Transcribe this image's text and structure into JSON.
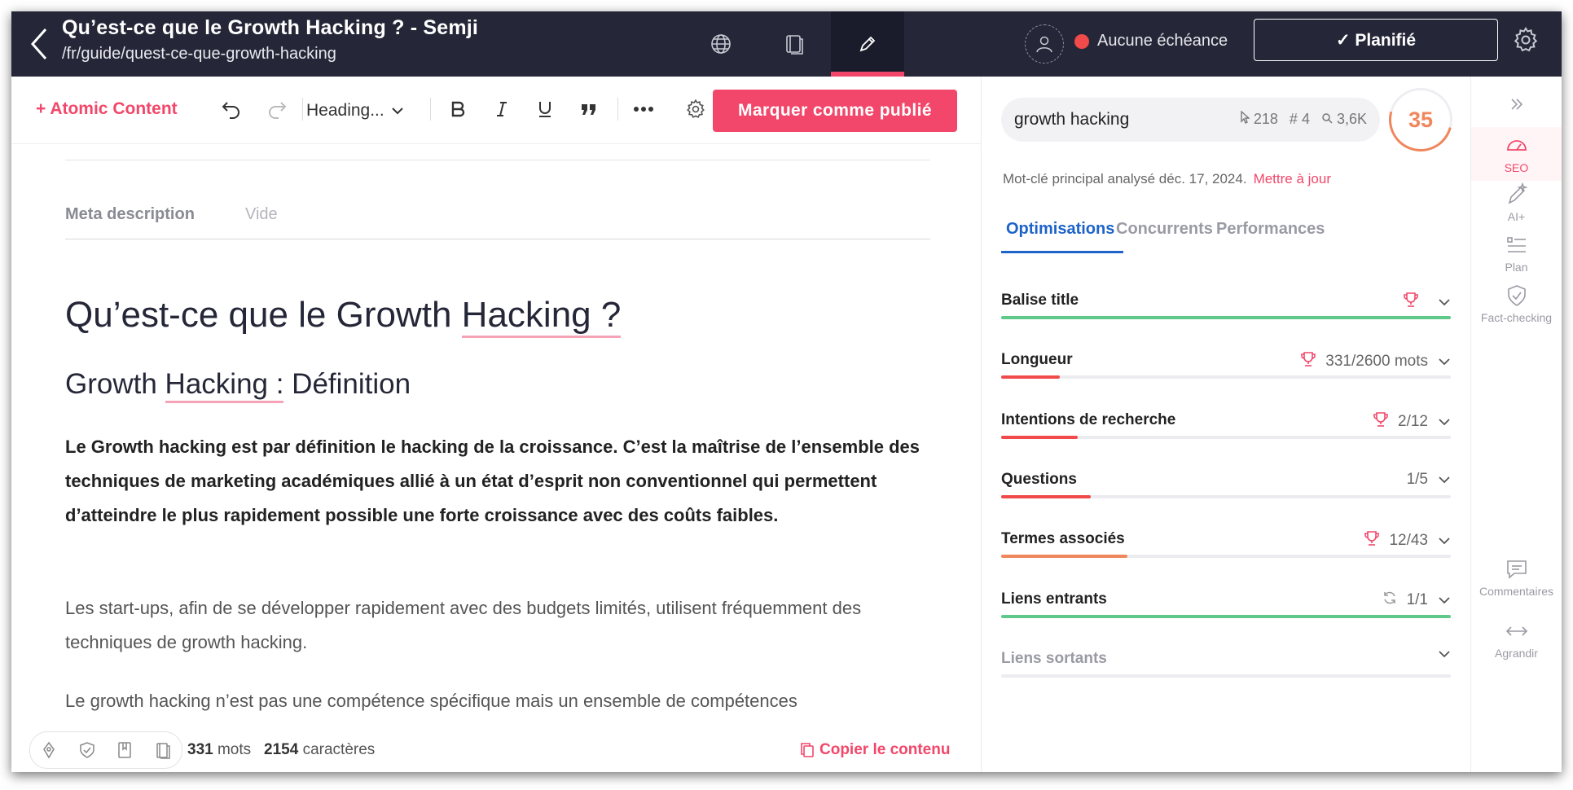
{
  "header": {
    "title": "Qu’est-ce que le Growth Hacking ? - Semji",
    "url": "/fr/guide/quest-ce-que-growth-hacking",
    "deadline": "Aucune échéance",
    "status_button": "✓ Planifié"
  },
  "toolbar": {
    "atomic_content": "+ Atomic Content",
    "heading_select": "Heading...",
    "publish_button": "Marquer comme publié"
  },
  "editor": {
    "meta_label": "Meta description",
    "meta_value": "Vide",
    "h1_part1": "Qu’est-ce que le Growth ",
    "h1_part2": "Hacking ?",
    "h2_part1": "Growth ",
    "h2_part2": "Hacking :",
    "h2_part3": " Définition",
    "intro": "Le Growth hacking est par définition le hacking de la croissance. C’est la maîtrise de l’ensemble des techniques de marketing académiques allié à un état d’esprit non conventionnel qui permettent d’atteindre le plus rapidement possible une forte croissance avec des coûts faibles.",
    "p1": "Les start-ups, afin de se développer rapidement avec des budgets limités, utilisent fréquemment des techniques de growth hacking.",
    "p2": "Le growth hacking n’est pas une compétence spécifique mais un ensemble de compétences"
  },
  "footer": {
    "word_count": "331",
    "word_label": "mots",
    "char_count": "2154",
    "char_label": "caractères",
    "copy": "Copier le contenu"
  },
  "panel": {
    "keyword": "growth hacking",
    "clicks": "218",
    "rank": "4",
    "volume": "3,6K",
    "score": "35",
    "analysis_note": "Mot-clé principal analysé déc. 17, 2024.",
    "update_link": "Mettre à jour",
    "tabs": [
      "Optimisations",
      "Concurrents",
      "Performances"
    ],
    "optimizations": [
      {
        "label": "Balise title",
        "value": "",
        "progress": 1.0,
        "color": "#5fc98a",
        "icon": "trophy"
      },
      {
        "label": "Longueur",
        "value": "331/2600 mots",
        "progress": 0.13,
        "color": "#f04a4a",
        "icon": "trophy"
      },
      {
        "label": "Intentions de recherche",
        "value": "2/12",
        "progress": 0.17,
        "color": "#f04a4a",
        "icon": "trophy"
      },
      {
        "label": "Questions",
        "value": "1/5",
        "progress": 0.2,
        "color": "#f04a4a",
        "icon": ""
      },
      {
        "label": "Termes associés",
        "value": "12/43",
        "progress": 0.28,
        "color": "#f0875c",
        "icon": "trophy"
      },
      {
        "label": "Liens entrants",
        "value": "1/1",
        "progress": 1.0,
        "color": "#5fc98a",
        "icon": "refresh"
      },
      {
        "label": "Liens sortants",
        "value": "",
        "progress": 0,
        "color": "#ececf0",
        "icon": ""
      }
    ]
  },
  "sidebar": {
    "seo": "SEO",
    "ai": "AI+",
    "plan": "Plan",
    "fact": "Fact-checking",
    "comments": "Commentaires",
    "expand": "Agrandir"
  }
}
